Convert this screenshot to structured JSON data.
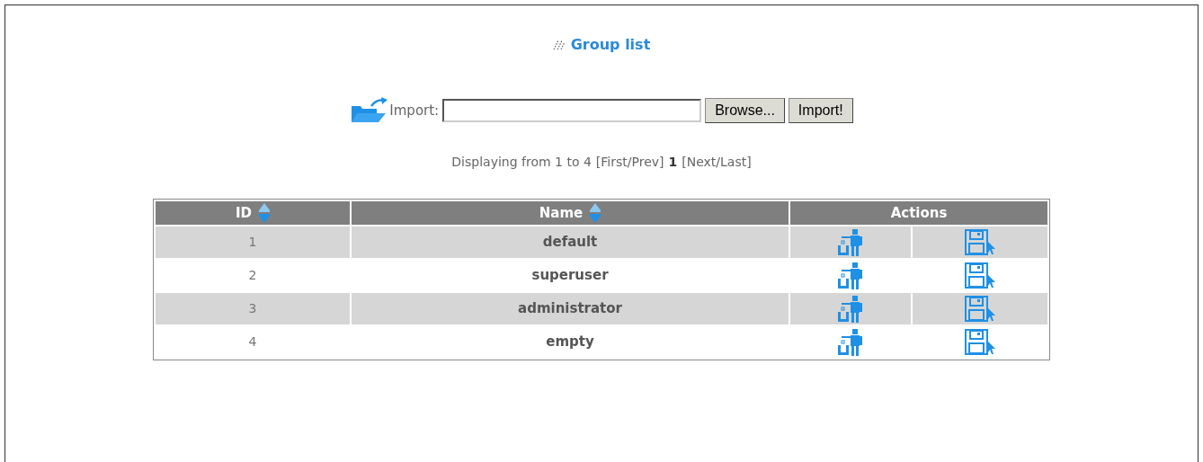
{
  "title": "Group list",
  "import": {
    "label": "Import:",
    "buttons": [
      "Browse...",
      "Import!"
    ]
  },
  "pagination": {
    "prefix": "Displaying from 1 to 4",
    "first_prev": "[First/Prev]",
    "current": "1",
    "next_last": "[Next/Last]"
  },
  "table": {
    "columns": [
      {
        "label": "ID",
        "sortable": true
      },
      {
        "label": "Name",
        "sortable": true
      },
      {
        "label": "Actions",
        "sortable": false
      }
    ],
    "rows": [
      {
        "id": "1",
        "name": "default"
      },
      {
        "id": "2",
        "name": "superuser"
      },
      {
        "id": "3",
        "name": "administrator"
      },
      {
        "id": "4",
        "name": "empty"
      }
    ]
  }
}
